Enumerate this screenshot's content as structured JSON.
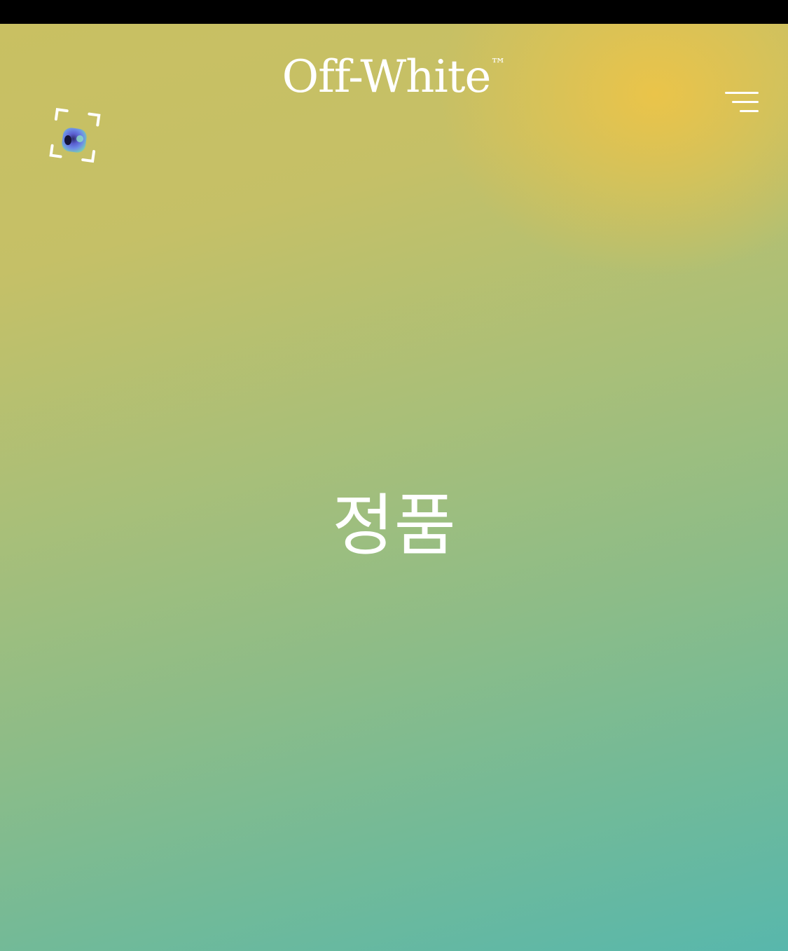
{
  "header": {
    "brand_name": "Off-White",
    "brand_mark": "™",
    "scanner_icon": "camera-scan-icon",
    "menu_icon": "hamburger-menu-icon"
  },
  "main": {
    "title": "정품"
  },
  "colors": {
    "gradient_top": "#c9c062",
    "gradient_accent_top_right": "#ecc448",
    "gradient_bottom": "#58b7ac",
    "text": "#ffffff",
    "status_bar": "#000000"
  }
}
